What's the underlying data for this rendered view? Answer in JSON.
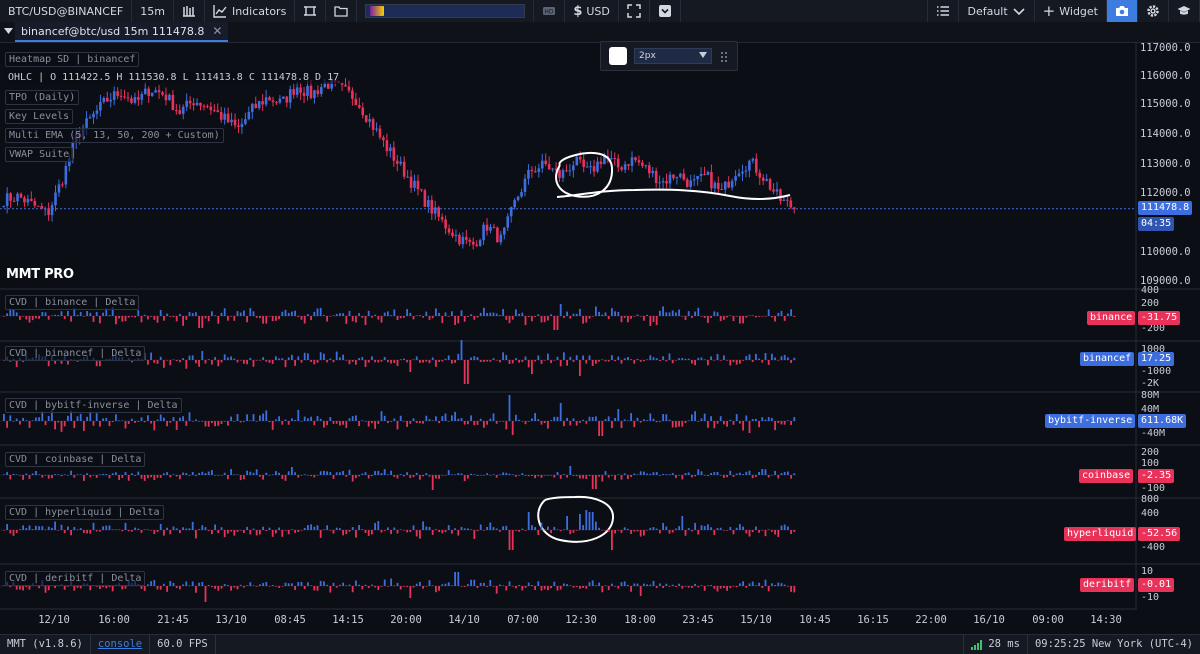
{
  "toolbar": {
    "symbol": "BTC/USD@BINANCEF",
    "timeframe": "15m",
    "indicators_label": "Indicators",
    "currency_label": "USD",
    "layout_label": "Default",
    "widget_label": "Widget",
    "icons": [
      "bars-chart-icon",
      "line-chart-icon",
      "crop-icon",
      "folder-icon",
      "hd-icon",
      "dollar-icon",
      "fullscreen-icon",
      "dropdown-box-icon",
      "list-icon",
      "chevron-down-icon",
      "plus-icon",
      "camera-icon",
      "gear-icon",
      "graduation-cap-icon"
    ]
  },
  "tab": {
    "label": "binancef@btc/usd 15m 111478.8",
    "close": "✕"
  },
  "legend": {
    "heatmap": "Heatmap SD | binancef",
    "ohlc": "OHLC | O 111422.5 H 111530.8 L 111413.8 C 111478.8 D 17",
    "tpo": "TPO (Daily)",
    "key_levels": "Key Levels",
    "ema": "Multi EMA (5, 13, 50, 200 + Custom)",
    "vwap": "VWAP Suite"
  },
  "draw_panel": {
    "width_option": "2px",
    "color": "#ffffff"
  },
  "price_axis": {
    "ticks": [
      "117000.0",
      "116000.0",
      "115000.0",
      "114000.0",
      "113000.0",
      "112000.0",
      "110000.0",
      "109000.0"
    ],
    "last_price": "111478.8",
    "countdown": "04:35"
  },
  "brand": "MMT PRO",
  "panes": [
    {
      "title": "CVD | binance | Delta",
      "exchange": "binance",
      "value": "-31.75",
      "color": "#e8325a",
      "ticks": [
        "400",
        "200",
        "-200"
      ]
    },
    {
      "title": "CVD | binancef | Delta",
      "exchange": "binancef",
      "value": "17.25",
      "color": "#3d6ee0",
      "ticks": [
        "1000",
        "-1000",
        "-2K"
      ]
    },
    {
      "title": "CVD | bybitf-inverse | Delta",
      "exchange": "bybitf-inverse",
      "value": "611.68K",
      "color": "#3d6ee0",
      "ticks": [
        "80M",
        "40M",
        "-40M"
      ]
    },
    {
      "title": "CVD | coinbase | Delta",
      "exchange": "coinbase",
      "value": "-2.35",
      "color": "#e8325a",
      "ticks": [
        "200",
        "100",
        "-100"
      ]
    },
    {
      "title": "CVD | hyperliquid | Delta",
      "exchange": "hyperliquid",
      "value": "-52.56",
      "color": "#e8325a",
      "ticks": [
        "800",
        "400",
        "-400"
      ]
    },
    {
      "title": "CVD | deribitf | Delta",
      "exchange": "deribitf",
      "value": "-0.01",
      "color": "#e8325a",
      "ticks": [
        "10",
        "-10"
      ]
    }
  ],
  "time_axis": [
    "12/10",
    "16:00",
    "21:45",
    "13/10",
    "08:45",
    "14:15",
    "20:00",
    "14/10",
    "07:00",
    "12:30",
    "18:00",
    "23:45",
    "15/10",
    "10:45",
    "16:15",
    "22:00",
    "16/10",
    "09:00",
    "14:30"
  ],
  "status": {
    "version": "MMT (v1.8.6)",
    "console": "console",
    "fps": "60.0 FPS",
    "latency": "28 ms",
    "clock": "09:25:25 New York (UTC-4)"
  },
  "colors": {
    "bull": "#3d6ee0",
    "bear": "#e8325a",
    "accent": "#3d7de0",
    "background": "#0b0e14"
  },
  "chart_data": {
    "type": "candlestick",
    "symbol": "BTC/USD",
    "price_path": [
      111800,
      111900,
      111600,
      111300,
      112500,
      114000,
      114600,
      115200,
      115500,
      115100,
      115600,
      115400,
      114800,
      115200,
      115000,
      114600,
      114200,
      114900,
      115300,
      115100,
      115700,
      115400,
      115800,
      115600,
      115300,
      114500,
      113700,
      113000,
      112300,
      111600,
      111000,
      110500,
      110200,
      110900,
      110400,
      111800,
      112800,
      113000,
      112600,
      113100,
      112700,
      113300,
      112900,
      113200,
      112800,
      112400,
      112700,
      112300,
      112600,
      112000,
      112800,
      113100,
      112500,
      111800,
      111500
    ],
    "last": 111478.8
  }
}
